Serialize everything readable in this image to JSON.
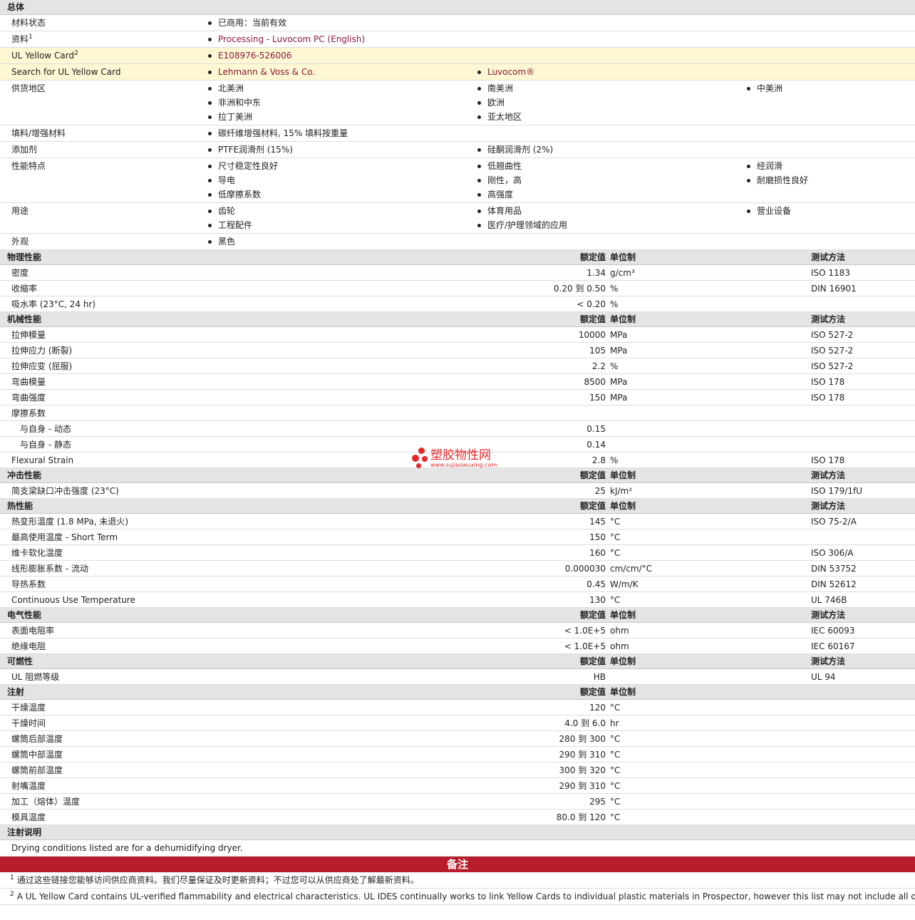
{
  "general": {
    "title": "总体",
    "rows": [
      {
        "name": "材料状态",
        "cols": [
          [
            "已商用：当前有效"
          ]
        ]
      },
      {
        "name": "资料",
        "sup": "1",
        "cols": [
          [
            "Processing - Luvocom PC (English)"
          ]
        ],
        "link": true
      },
      {
        "name": "UL Yellow Card",
        "sup": "2",
        "cols": [
          [
            "E108976-526006"
          ]
        ],
        "link": true,
        "yellow": true
      },
      {
        "name": "Search for UL Yellow Card",
        "cols": [
          [
            "Lehmann & Voss & Co."
          ],
          [
            "Luvocom®"
          ]
        ],
        "link": true,
        "yellow": true
      },
      {
        "name": "供货地区",
        "cols": [
          [
            "北美洲",
            "非洲和中东",
            "拉丁美洲"
          ],
          [
            "南美洲",
            "欧洲",
            "亚太地区"
          ],
          [
            "中美洲"
          ]
        ]
      },
      {
        "name": "填料/增强材料",
        "cols": [
          [
            "碳纤维增强材料, 15% 填料按重量"
          ]
        ]
      },
      {
        "name": "添加剂",
        "cols": [
          [
            "PTFE润滑剂 (15%)"
          ],
          [
            "硅酮润滑剂 (2%)"
          ]
        ]
      },
      {
        "name": "性能特点",
        "cols": [
          [
            "尺寸稳定性良好",
            "导电",
            "低摩擦系数"
          ],
          [
            "低翘曲性",
            "刚性，高",
            "高强度"
          ],
          [
            "经润滑",
            "耐磨损性良好"
          ]
        ]
      },
      {
        "name": "用途",
        "cols": [
          [
            "齿轮",
            "工程配件"
          ],
          [
            "体育用品",
            "医疗/护理领域的应用"
          ],
          [
            "营业设备"
          ]
        ]
      },
      {
        "name": "外观",
        "cols": [
          [
            "黑色"
          ]
        ]
      }
    ]
  },
  "col_headers": {
    "nominal": "额定值",
    "unit": "单位制",
    "test": "测试方法"
  },
  "sections": [
    {
      "title": "物理性能",
      "show_test": true,
      "rows": [
        {
          "name": "密度",
          "nom": "1.34",
          "unit": "g/cm³",
          "test": "ISO 1183"
        },
        {
          "name": "收缩率",
          "nom": "0.20 到  0.50",
          "unit": "%",
          "test": "DIN 16901"
        },
        {
          "name": "吸水率 (23°C, 24 hr)",
          "nom": "< 0.20",
          "unit": "%",
          "test": ""
        }
      ]
    },
    {
      "title": "机械性能",
      "show_test": true,
      "rows": [
        {
          "name": "拉伸模量",
          "nom": "10000",
          "unit": "MPa",
          "test": "ISO 527-2"
        },
        {
          "name": "拉伸应力 (断裂)",
          "nom": "105",
          "unit": "MPa",
          "test": "ISO 527-2"
        },
        {
          "name": "拉伸应变 (屈服)",
          "nom": "2.2",
          "unit": "%",
          "test": "ISO 527-2"
        },
        {
          "name": "弯曲模量",
          "nom": "8500",
          "unit": "MPa",
          "test": "ISO 178"
        },
        {
          "name": "弯曲强度",
          "nom": "150",
          "unit": "MPa",
          "test": "ISO 178"
        },
        {
          "name": "摩擦系数",
          "nom": "",
          "unit": "",
          "test": ""
        },
        {
          "name": "与自身  - 动态",
          "nom": "0.15",
          "unit": "",
          "test": "",
          "indent": true
        },
        {
          "name": "与自身  - 静态",
          "nom": "0.14",
          "unit": "",
          "test": "",
          "indent": true
        },
        {
          "name": "Flexural Strain",
          "nom": "2.8",
          "unit": "%",
          "test": "ISO 178"
        }
      ]
    },
    {
      "title": "冲击性能",
      "show_test": true,
      "rows": [
        {
          "name": "简支梁缺口冲击强度 (23°C)",
          "nom": "25",
          "unit": "kJ/m²",
          "test": "ISO 179/1fU"
        }
      ]
    },
    {
      "title": "热性能",
      "show_test": true,
      "rows": [
        {
          "name": "热变形温度 (1.8 MPa, 未退火)",
          "nom": "145",
          "unit": "°C",
          "test": "ISO 75-2/A"
        },
        {
          "name": "最高使用温度  - Short Term",
          "nom": "150",
          "unit": "°C",
          "test": ""
        },
        {
          "name": "维卡软化温度",
          "nom": "160",
          "unit": "°C",
          "test": "ISO 306/A"
        },
        {
          "name": "线形膨胀系数  - 流动",
          "nom": "0.000030",
          "unit": "cm/cm/°C",
          "test": "DIN 53752"
        },
        {
          "name": "导热系数",
          "nom": "0.45",
          "unit": "W/m/K",
          "test": "DIN 52612"
        },
        {
          "name": "Continuous Use Temperature",
          "nom": "130",
          "unit": "°C",
          "test": "UL 746B"
        }
      ]
    },
    {
      "title": "电气性能",
      "show_test": true,
      "rows": [
        {
          "name": "表面电阻率",
          "nom": "< 1.0E+5",
          "unit": "ohm",
          "test": "IEC 60093"
        },
        {
          "name": "绝缘电阻",
          "nom": "< 1.0E+5",
          "unit": "ohm",
          "test": "IEC 60167"
        }
      ]
    },
    {
      "title": "可燃性",
      "show_test": true,
      "rows": [
        {
          "name": "UL 阻燃等级",
          "nom": "HB",
          "unit": "",
          "test": "UL 94"
        }
      ]
    },
    {
      "title": "注射",
      "show_test": false,
      "rows": [
        {
          "name": "干燥温度",
          "nom": "120",
          "unit": "°C",
          "test": ""
        },
        {
          "name": "干燥时间",
          "nom": "4.0 到  6.0",
          "unit": "hr",
          "test": ""
        },
        {
          "name": "螺筒后部温度",
          "nom": "280 到  300",
          "unit": "°C",
          "test": ""
        },
        {
          "name": "螺筒中部温度",
          "nom": "290 到  310",
          "unit": "°C",
          "test": ""
        },
        {
          "name": "螺筒前部温度",
          "nom": "300 到  320",
          "unit": "°C",
          "test": ""
        },
        {
          "name": "射嘴温度",
          "nom": "290 到  310",
          "unit": "°C",
          "test": ""
        },
        {
          "name": "加工（熔体）温度",
          "nom": "295",
          "unit": "°C",
          "test": ""
        },
        {
          "name": "模具温度",
          "nom": "80.0 到  120",
          "unit": "°C",
          "test": ""
        }
      ]
    }
  ],
  "injection_notes": {
    "title": "注射说明",
    "text": "Drying conditions listed are for a dehumidifying dryer."
  },
  "notes": {
    "title": "备注",
    "items": [
      {
        "sup": "1",
        "text": "通过这些链接您能够访问供应商资料。我们尽量保证及时更新资料；不过您可以从供应商处了解最新资料。"
      },
      {
        "sup": "2",
        "text": "A UL Yellow Card contains UL-verified flammability and electrical characteristics. UL IDES continually works to link Yellow Cards to individual plastic materials in Prospector, however this list may not include all of the appropriate links."
      }
    ]
  },
  "watermark": {
    "title": "塑胶物性网",
    "url": "www.sujiaowuxing.com"
  }
}
